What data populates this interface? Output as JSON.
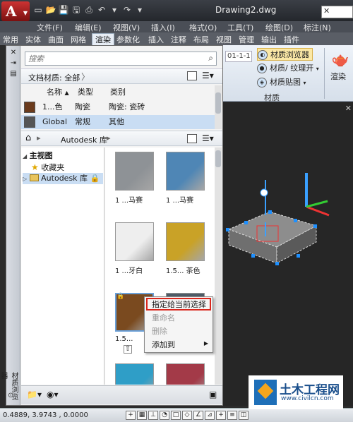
{
  "titlebar": {
    "document_title": "Drawing2.dwg",
    "app_logo": "A"
  },
  "menubar": {
    "items": [
      "文件(F)",
      "编辑(E)",
      "视图(V)",
      "插入(I)",
      "格式(O)",
      "工具(T)",
      "绘图(D)",
      "标注(N)"
    ]
  },
  "ribbon_tabs": {
    "items": [
      "常用",
      "实体",
      "曲面",
      "网格",
      "渲染",
      "参数化",
      "插入",
      "注释",
      "布局",
      "视图",
      "管理",
      "输出",
      "插件"
    ],
    "active": "渲染"
  },
  "ribbon": {
    "date_value": "01-1-1",
    "material_browser": "材质浏览器",
    "material_texture": "材质/ 纹理开",
    "material_mapping": "材质贴图",
    "panel_label": "材质",
    "render_label": "渲染"
  },
  "palette": {
    "vertical_label": "材质浏览器",
    "search_placeholder": "搜索",
    "doc_materials_label": "文档材质: 全部",
    "table_headers": {
      "name": "名称",
      "type": "类型",
      "category": "类别"
    },
    "table_rows": [
      {
        "name": "1...色",
        "type": "陶瓷",
        "category": "陶瓷: 瓷砖",
        "swatch": "#6b3b1c"
      },
      {
        "name": "Global",
        "type": "常规",
        "category": "其他",
        "swatch": "#555555"
      }
    ],
    "library_label": "Autodesk 库",
    "tree": {
      "root": "主视图",
      "favorites": "收藏夹",
      "library": "Autodesk 库"
    },
    "tiles": [
      {
        "label": "1 ...马赛",
        "color": "#8e9296"
      },
      {
        "label": "1 ...马赛",
        "color": "#4f86b5"
      },
      {
        "label": "1 ...牙白",
        "color": "#eeeeee"
      },
      {
        "label": "1.5... 茶色",
        "color": "#c9a227"
      },
      {
        "label": "1.5... ",
        "color": "#7a4a1f"
      },
      {
        "label": "",
        "color": "#4d5b66"
      },
      {
        "label": "",
        "color": "#2f9ec7"
      },
      {
        "label": "",
        "color": "#a33a48"
      }
    ]
  },
  "context_menu": {
    "items": [
      "指定给当前选择",
      "重命名",
      "删除",
      "添加到"
    ]
  },
  "statusbar": {
    "coords": "0.4889,  3.9743 ,  0.0000"
  },
  "watermark": {
    "title": "土木工程网",
    "url": "www.civilcn.com"
  }
}
